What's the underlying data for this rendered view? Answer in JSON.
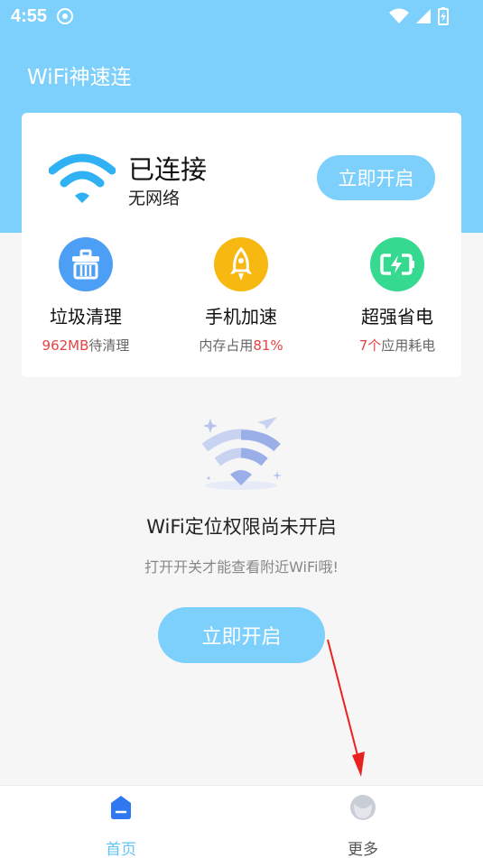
{
  "status_bar": {
    "time": "4:55"
  },
  "app": {
    "title": "WiFi神速连"
  },
  "connection": {
    "status": "已连接",
    "network": "无网络",
    "action_label": "立即开启"
  },
  "features": [
    {
      "title": "垃圾清理",
      "sub_highlight": "962MB",
      "sub_rest": "待清理",
      "icon": "trash-basket-icon",
      "color": "#4d9ff5"
    },
    {
      "title": "手机加速",
      "sub_prefix": "内存占用",
      "sub_highlight": "81%",
      "icon": "rocket-icon",
      "color": "#f7b812"
    },
    {
      "title": "超强省电",
      "sub_highlight": "7个",
      "sub_rest": "应用耗电",
      "icon": "battery-charge-icon",
      "color": "#35d98f"
    }
  ],
  "permission": {
    "title": "WiFi定位权限尚未开启",
    "subtitle": "打开开关才能查看附近WiFi哦!",
    "button_label": "立即开启"
  },
  "bottom_nav": [
    {
      "label": "首页",
      "active": true,
      "icon": "home-icon"
    },
    {
      "label": "更多",
      "active": false,
      "icon": "more-face-icon"
    }
  ],
  "colors": {
    "primary": "#7dd0fb",
    "highlight": "#e84343",
    "active_nav": "#62c4f6",
    "inactive_nav": "#555555"
  }
}
